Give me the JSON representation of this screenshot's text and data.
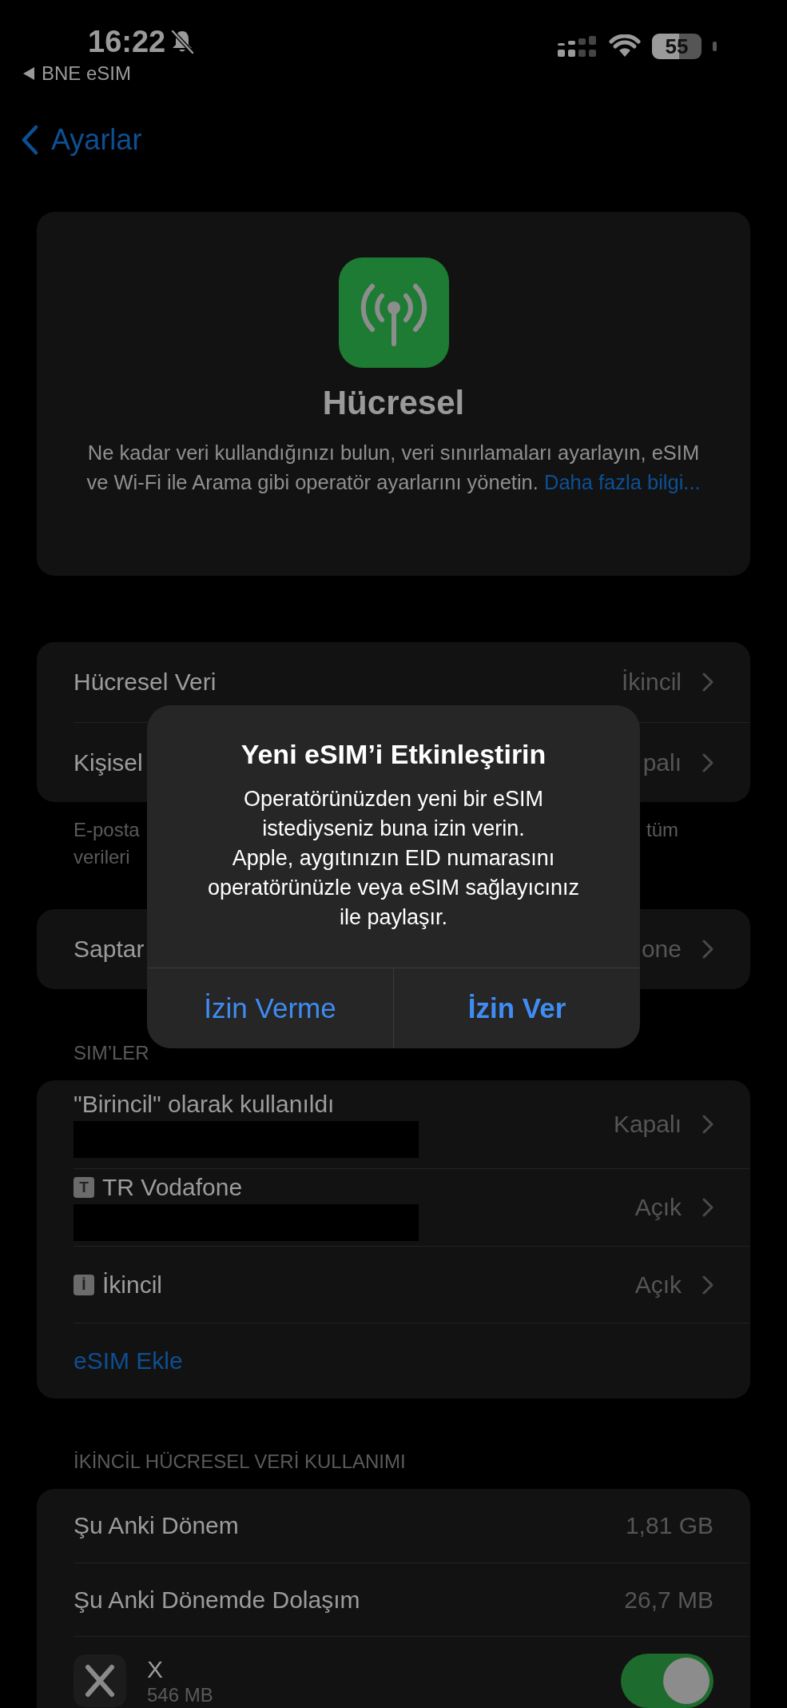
{
  "status_bar": {
    "time": "16:22",
    "silent": true,
    "back_app": "BNE eSIM",
    "battery": "55"
  },
  "nav": {
    "back_label": "Ayarlar"
  },
  "hero": {
    "title": "Hücresel",
    "description": "Ne kadar veri kullandığınızı bulun, veri sınırlamaları ayarlayın, eSIM ve Wi-Fi ile Arama gibi operatör ayarlarını yönetin.",
    "link": "Daha fazla bilgi..."
  },
  "groups": [
    {
      "rows": [
        {
          "kind": "value",
          "label": "Hücresel Veri",
          "value": "İkincil",
          "chevron": true
        },
        {
          "kind": "value",
          "label": "Kişisel",
          "value": "palı",
          "chevron": true
        }
      ],
      "footer": {
        "left": [
          "E-posta",
          "verileri"
        ],
        "right": "tüm"
      }
    },
    {
      "rows": [
        {
          "kind": "value",
          "label": "Saptar",
          "value": "one",
          "chevron": true
        }
      ]
    },
    {
      "header": "SIM’LER",
      "rows": [
        {
          "kind": "sim",
          "label": "\"Birincil\" olarak kullanıldı",
          "value": "Kapalı",
          "chevron": true,
          "redacted": true
        },
        {
          "kind": "sim",
          "badge": "T",
          "label": "TR Vodafone",
          "value": "Açık",
          "chevron": true,
          "redacted": true
        },
        {
          "kind": "sim",
          "badge": "İ",
          "label": "İkincil",
          "value": "Açık",
          "chevron": true,
          "redacted": false
        },
        {
          "kind": "action",
          "label": "eSIM Ekle"
        }
      ]
    },
    {
      "header": "İKİNCİL HÜCRESEL VERİ KULLANIMI",
      "rows": [
        {
          "kind": "value",
          "label": "Şu Anki Dönem",
          "value": "1,81 GB",
          "chevron": false
        },
        {
          "kind": "value",
          "label": "Şu Anki Dönemde Dolaşım",
          "value": "26,7 MB",
          "chevron": false
        },
        {
          "kind": "app",
          "label": "X",
          "detail": "546 MB",
          "on": true
        }
      ]
    }
  ],
  "alert": {
    "title": "Yeni eSIM’i Etkinleştirin",
    "message": "Operatörünüzden yeni bir eSIM\nistediyseniz buna izin verin.\nApple, aygıtınızın EID numarasını\noperatörünüzle veya eSIM sağlayıcınız\nile paylaşır.",
    "buttons": [
      {
        "label": "İzin Verme",
        "bold": false
      },
      {
        "label": "İzin Ver",
        "bold": true
      }
    ]
  }
}
